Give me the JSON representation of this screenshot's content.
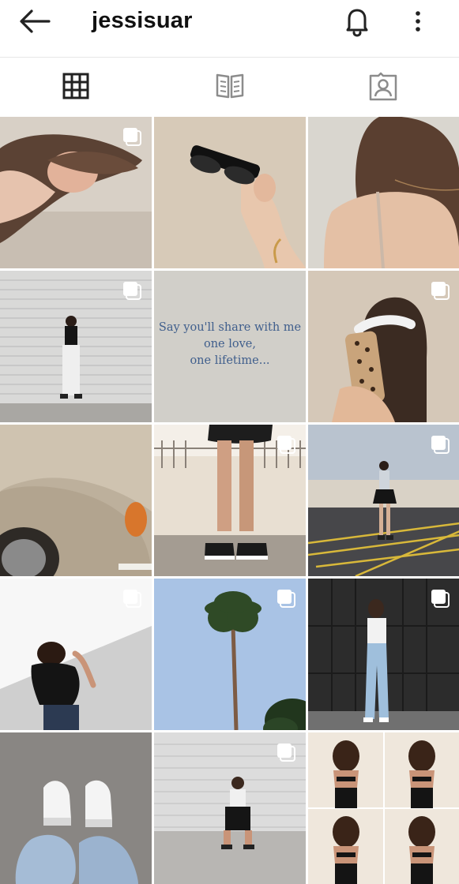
{
  "header": {
    "username": "jessisuar",
    "icons": [
      "back-arrow-icon",
      "bell-icon",
      "more-vertical-icon"
    ]
  },
  "tabs": [
    {
      "name": "grid",
      "icon": "grid-icon",
      "active": true
    },
    {
      "name": "guide",
      "icon": "book-icon",
      "active": false
    },
    {
      "name": "tagged",
      "icon": "tagged-person-icon",
      "active": false
    }
  ],
  "posts": [
    {
      "id": 1,
      "description": "girl lying with long hair",
      "multi": true
    },
    {
      "id": 2,
      "description": "hand holding black sunglasses",
      "multi": false
    },
    {
      "id": 3,
      "description": "shoulder with necklace",
      "multi": false
    },
    {
      "id": 4,
      "description": "girl by white shutter",
      "multi": true
    },
    {
      "id": 5,
      "quote": [
        "Say you'll share with me",
        "one love,",
        "one lifetime..."
      ],
      "multi": false
    },
    {
      "id": 6,
      "description": "mirror selfie leopard case",
      "multi": true
    },
    {
      "id": 7,
      "description": "beige vintage car",
      "multi": false
    },
    {
      "id": 8,
      "description": "legs in converse",
      "multi": true
    },
    {
      "id": 9,
      "description": "girl on parking lot",
      "multi": true
    },
    {
      "id": 10,
      "description": "shadow girl on wall",
      "multi": true
    },
    {
      "id": 11,
      "description": "palm tree blue sky",
      "multi": true
    },
    {
      "id": 12,
      "description": "girl by dark shutter",
      "multi": true
    },
    {
      "id": 13,
      "description": "white sneakers jeans",
      "multi": false
    },
    {
      "id": 14,
      "description": "girl sitting by wall",
      "multi": true
    },
    {
      "id": 15,
      "description": "back view collage",
      "multi": false
    }
  ],
  "colors": {
    "accent_text": "#3f5e8c",
    "icon": "#222222",
    "divider": "#e6e6e6"
  }
}
